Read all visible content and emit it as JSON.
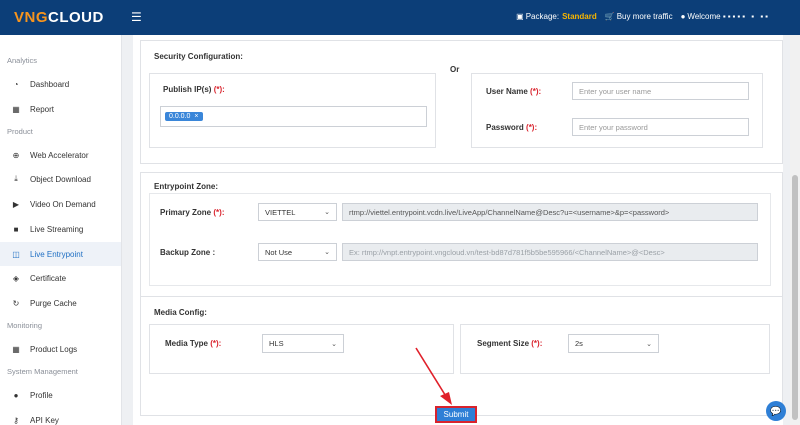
{
  "header": {
    "logo_prefix": "VNG",
    "logo_suffix": "CLOUD",
    "menu_icon": "hamburger-icon",
    "package_label": "Package:",
    "package_value": "Standard",
    "buy_traffic": "Buy more traffic",
    "welcome": "Welcome",
    "username_masked": "▪▪▪▪▪ ▪ ▪▪"
  },
  "sidebar": {
    "sections": [
      "Analytics",
      "Product",
      "Monitoring",
      "System Management"
    ],
    "items": [
      {
        "label": "Dashboard",
        "icon": "dashboard-icon"
      },
      {
        "label": "Report",
        "icon": "calendar-icon"
      },
      {
        "label": "Web Accelerator",
        "icon": "globe-icon"
      },
      {
        "label": "Object Download",
        "icon": "download-icon"
      },
      {
        "label": "Video On Demand",
        "icon": "video-icon"
      },
      {
        "label": "Live Streaming",
        "icon": "camera-icon"
      },
      {
        "label": "Live Entrypoint",
        "icon": "cast-icon"
      },
      {
        "label": "Certificate",
        "icon": "shield-icon"
      },
      {
        "label": "Purge Cache",
        "icon": "refresh-icon"
      },
      {
        "label": "Product Logs",
        "icon": "calendar-icon"
      },
      {
        "label": "Profile",
        "icon": "user-icon"
      },
      {
        "label": "API Key",
        "icon": "key-icon"
      }
    ],
    "active_item": "Live Entrypoint"
  },
  "security": {
    "title": "Security Configuration:",
    "or": "Or",
    "publish_ip_label": "Publish IP(s)",
    "required_mark": "(*):",
    "publish_ip_tag": "0.0.0.0",
    "tag_remove": "×",
    "username_label": "User Name",
    "username_placeholder": "Enter your user name",
    "password_label": "Password",
    "password_placeholder": "Enter your password"
  },
  "entrypoint": {
    "title": "Entrypoint Zone:",
    "primary_label": "Primary Zone",
    "primary_required": "(*):",
    "primary_value": "VIETTEL",
    "primary_url": "rtmp://viettel.entrypoint.vcdn.live/LiveApp/ChannelName@Desc?u=<username>&p=<password>",
    "backup_label": "Backup Zone :",
    "backup_value": "Not Use",
    "backup_url": "Ex: rtmp://vnpt.entrypoint.vngcloud.vn/test-bd87d781f5b5be595966/<ChannelName>@<Desc>"
  },
  "media": {
    "title": "Media Config:",
    "media_type_label": "Media Type",
    "media_type_required": "(*):",
    "media_type_value": "HLS",
    "segment_label": "Segment Size",
    "segment_required": "(*):",
    "segment_value": "2s"
  },
  "actions": {
    "submit": "Submit"
  },
  "colors": {
    "topbar": "#0c3e78",
    "accent": "#2e7fd6",
    "required": "#d9232d",
    "package_highlight": "#f7b500",
    "annotation_arrow": "#e0202a"
  }
}
